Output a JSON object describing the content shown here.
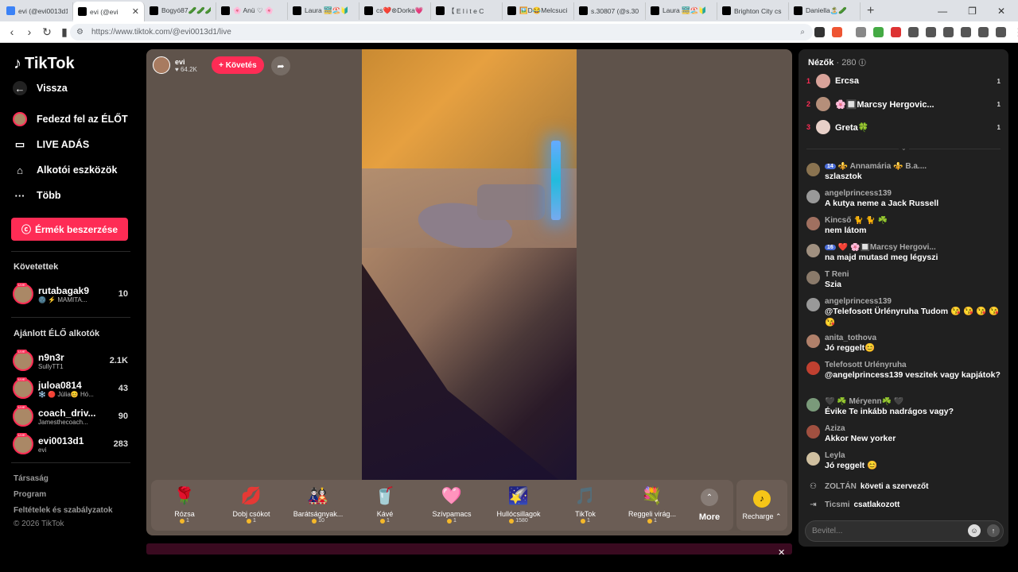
{
  "browser": {
    "tabs": [
      {
        "label": "evi (@evi0013d1",
        "active": false
      },
      {
        "label": "evi (@evi",
        "active": true
      },
      {
        "label": "Bogyó87🥒🥒🥒",
        "active": false
      },
      {
        "label": "🌸 Anü ♡ 🌸",
        "active": false
      },
      {
        "label": "Laura 🚟🏖️🔰",
        "active": false
      },
      {
        "label": "cs❤️⊛Dorka💗",
        "active": false
      },
      {
        "label": "【 E l i t e C",
        "active": false
      },
      {
        "label": "🖼️D😂Melcsuci",
        "active": false
      },
      {
        "label": "s.30807 (@s.30",
        "active": false
      },
      {
        "label": "Laura 🚟🏖️🔰",
        "active": false
      },
      {
        "label": "Brighton City cs",
        "active": false
      },
      {
        "label": "Daniella🏝️🥒",
        "active": false
      }
    ],
    "url": "https://www.tiktok.com/@evi0013d1/live"
  },
  "sidebar": {
    "logo": "TikTok",
    "back": "Vissza",
    "nav": [
      {
        "label": "Fedezd fel az ÉLŐT",
        "icon": "avatar-icon"
      },
      {
        "label": "LIVE ADÁS",
        "icon": "video-camera-icon"
      },
      {
        "label": "Alkotói eszközök",
        "icon": "house-icon"
      },
      {
        "label": "Több",
        "icon": "more-dots-icon"
      }
    ],
    "coins_button": "Érmék beszerzése",
    "following_title": "Követettek",
    "following": [
      {
        "name": "rutabagak9",
        "sub": "🌚 ⚡ MAMITA...",
        "count": "10"
      }
    ],
    "recommended_title": "Ajánlott ÉLŐ alkotók",
    "recommended": [
      {
        "name": "n9n3r",
        "sub": "SullyTT1",
        "count": "2.1K"
      },
      {
        "name": "juloa0814",
        "sub": "❄️ 🔴 Júlia😊 Hó...",
        "count": "43"
      },
      {
        "name": "coach_driv...",
        "sub": "Jamesthecoach...",
        "count": "90"
      },
      {
        "name": "evi0013d1",
        "sub": "evi",
        "count": "283"
      }
    ],
    "footer": [
      "Társaság",
      "Program",
      "Feltételek és szabályzatok",
      "© 2026 TikTok"
    ]
  },
  "stream": {
    "host_name": "evi",
    "host_likes": "♥ 64.2K",
    "follow_label": "+ Követés",
    "gifts": [
      {
        "icon": "🌹",
        "name": "Rózsa",
        "price": "1"
      },
      {
        "icon": "💋",
        "name": "Dobj csókot",
        "price": "1"
      },
      {
        "icon": "🎎",
        "name": "Barátságnyak...",
        "price": "10"
      },
      {
        "icon": "🥤",
        "name": "Kávé",
        "price": "1"
      },
      {
        "icon": "🩷",
        "name": "Szívpamacs",
        "price": "1"
      },
      {
        "icon": "🌠",
        "name": "Hullócsillagok",
        "price": "1580"
      },
      {
        "icon": "🎵",
        "name": "TikTok",
        "price": "1"
      },
      {
        "icon": "💐",
        "name": "Reggeli virág...",
        "price": "1"
      }
    ],
    "more_label": "More",
    "recharge_label": "Recharge ⌃"
  },
  "chat": {
    "viewers_title": "Nézők",
    "viewers_count": "· 280",
    "top_viewers": [
      {
        "rank": "1",
        "name": "Ercsa",
        "count": "1"
      },
      {
        "rank": "2",
        "name": "🌸🔲Marcsy Hergovic...",
        "count": "1"
      },
      {
        "rank": "3",
        "name": "Greta🍀",
        "count": "1"
      }
    ],
    "messages": [
      {
        "user": "⚜️ Annamária ⚜️ B.a....",
        "badge": "14",
        "text": "szlasztok"
      },
      {
        "user": "angelprincess139",
        "badge": "",
        "text": "A kutya neme a Jack Russell"
      },
      {
        "user": "Kincső 🐈 🐈 ☘️",
        "badge": "",
        "text": "nem látom"
      },
      {
        "user": "❤️ 🌸🔲Marcsy Hergovi...",
        "badge": "16",
        "text": "na majd mutasd meg légyszi"
      },
      {
        "user": "T Reni",
        "badge": "",
        "text": "Szia"
      },
      {
        "user": "angelprincess139",
        "badge": "",
        "text": "@Telefosott Ürlényruha Tudom 😘 😘 😘 😘 😘"
      },
      {
        "user": "anita_tothova",
        "badge": "",
        "text": "Jó reggelt😊"
      },
      {
        "user": "Telefosott Ürlényruha",
        "badge": "",
        "text": "@angelprincess139 veszitek vagy kapjátok?"
      },
      {
        "user": "🖤 ☘️ Méryenn☘️ 🖤",
        "badge": "",
        "text": "Évike Te inkább nadrágos vagy?"
      },
      {
        "user": "Aziza",
        "badge": "",
        "text": "Akkor New yorker"
      },
      {
        "user": "Leyla",
        "badge": "",
        "text": "Jó reggelt 😊"
      }
    ],
    "system": [
      {
        "name": "ZOLTÁN",
        "text": "követi a szervezőt"
      },
      {
        "name": "Ticsmi",
        "text": "csatlakozott"
      }
    ],
    "input_placeholder": "Bevitel..."
  }
}
